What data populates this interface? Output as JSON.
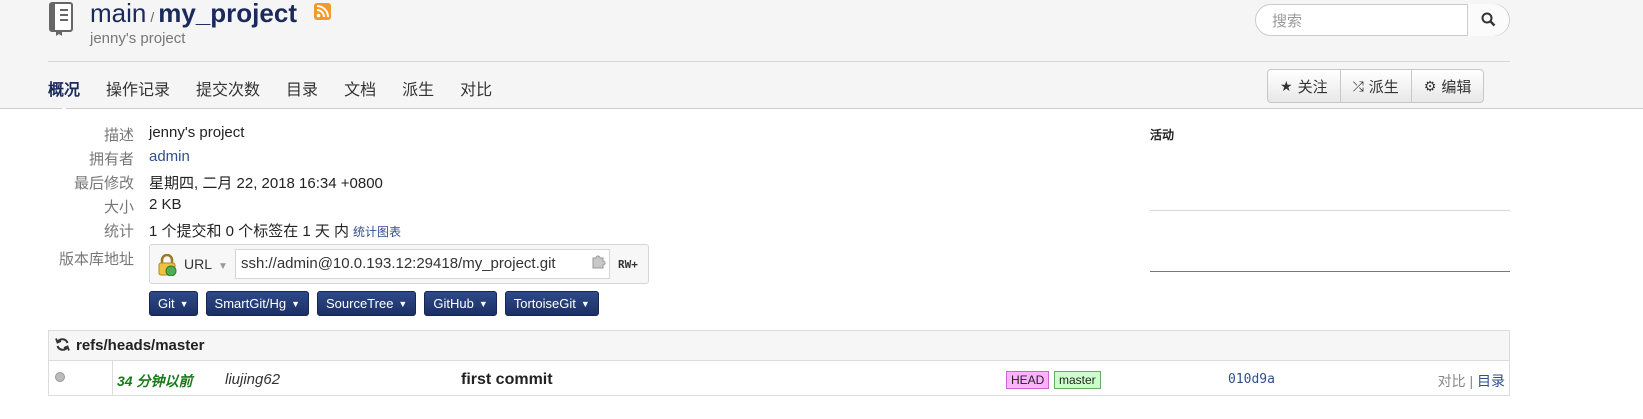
{
  "header": {
    "repo_prefix": "main",
    "separator": "/",
    "repo_name": "my_project",
    "description_sub": "jenny's project"
  },
  "search": {
    "placeholder": "搜索"
  },
  "tabs": [
    {
      "label": "概况",
      "active": true
    },
    {
      "label": "操作记录"
    },
    {
      "label": "提交次数"
    },
    {
      "label": "目录"
    },
    {
      "label": "文档"
    },
    {
      "label": "派生"
    },
    {
      "label": "对比"
    }
  ],
  "actions": {
    "watch": "关注",
    "fork": "派生",
    "edit": "编辑"
  },
  "summary": {
    "description": {
      "label": "描述",
      "value": "jenny's project"
    },
    "owner": {
      "label": "拥有者",
      "value": "admin"
    },
    "modified": {
      "label": "最后修改",
      "value": "星期四, 二月 22, 2018 16:34 +0800"
    },
    "size": {
      "label": "大小",
      "value": "2 KB"
    },
    "stats": {
      "label": "统计",
      "value": "1 个提交和 0 个标签在 1 天 内",
      "link": "统计图表"
    },
    "repo_url": {
      "label": "版本库地址",
      "type": "URL",
      "url": "ssh://admin@10.0.193.12:29418/my_project.git",
      "permission": "RW+"
    }
  },
  "clients": [
    "Git",
    "SmartGit/Hg",
    "SourceTree",
    "GitHub",
    "TortoiseGit"
  ],
  "activity": {
    "title": "活动"
  },
  "refs": {
    "heading": "refs/heads/master",
    "commits": [
      {
        "ago": "34 分钟以前",
        "author": "liujing62",
        "message": "first commit",
        "tags": [
          "HEAD",
          "master"
        ],
        "sha": "010d9a",
        "compare": "对比",
        "tree": "目录"
      }
    ]
  },
  "colors": {
    "accent": "#1b2a5a",
    "button": "#1b2f63",
    "ago_green": "#1a7a1a",
    "tag_head": "#ffb3ff",
    "tag_master": "#ccffcc"
  }
}
